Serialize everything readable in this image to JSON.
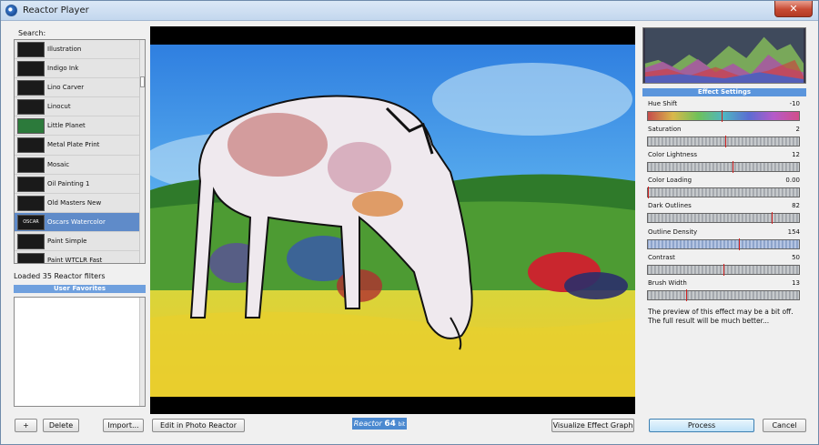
{
  "window": {
    "title": "Reactor Player",
    "close_glyph": "✕"
  },
  "left_panel": {
    "search_label": "Search:",
    "filters": [
      {
        "name": "Illustration",
        "icon": "illustration-thumb-icon"
      },
      {
        "name": "Indigo Ink",
        "icon": "indigo-ink-thumb-icon"
      },
      {
        "name": "Lino Carver",
        "icon": "lino-carver-thumb-icon"
      },
      {
        "name": "Linocut",
        "icon": "linocut-thumb-icon"
      },
      {
        "name": "Little Planet",
        "icon": "little-planet-thumb-icon"
      },
      {
        "name": "Metal Plate Print",
        "icon": "metal-plate-thumb-icon"
      },
      {
        "name": "Mosaic",
        "icon": "mosaic-thumb-icon"
      },
      {
        "name": "Oil Painting 1",
        "icon": "oil-painting-thumb-icon"
      },
      {
        "name": "Old Masters New",
        "icon": "old-masters-thumb-icon"
      },
      {
        "name": "Oscars Watercolor",
        "icon": "oscars-watercolor-thumb-icon",
        "thumb_text": "OSCAR"
      },
      {
        "name": "Paint Simple",
        "icon": "paint-simple-thumb-icon"
      },
      {
        "name": "Paint WTCLR Fast",
        "icon": "paint-wtclr-thumb-icon"
      }
    ],
    "selected_filter": "Oscars Watercolor",
    "loaded_text": "Loaded 35 Reactor filters",
    "favorites_header": "User Favorites"
  },
  "buttons": {
    "add": "+",
    "delete": "Delete",
    "import": "Import...",
    "edit": "Edit in Photo Reactor",
    "visualize": "Visualize Effect Graph",
    "process": "Process",
    "cancel": "Cancel"
  },
  "badge": {
    "brand": "Reactor",
    "num": "64",
    "unit": "bit"
  },
  "effect_settings": {
    "header": "Effect Settings",
    "sliders": [
      {
        "label": "Hue Shift",
        "value": "-10",
        "fraction": 0.49,
        "style": "hue"
      },
      {
        "label": "Saturation",
        "value": "2",
        "fraction": 0.51,
        "style": "gray"
      },
      {
        "label": "Color Lightness",
        "value": "12",
        "fraction": 0.56,
        "style": "gray"
      },
      {
        "label": "Color Loading",
        "value": "0.00",
        "fraction": 0.0,
        "style": "gray"
      },
      {
        "label": "Dark Outlines",
        "value": "82",
        "fraction": 0.82,
        "style": "gray"
      },
      {
        "label": "Outline Density",
        "value": "154",
        "fraction": 0.6,
        "style": "blue"
      },
      {
        "label": "Contrast",
        "value": "50",
        "fraction": 0.5,
        "style": "gray"
      },
      {
        "label": "Brush Width",
        "value": "13",
        "fraction": 0.25,
        "style": "gray"
      }
    ],
    "note": "The preview of this effect may be a bit off. The full result will be much better..."
  },
  "colors": {
    "accent": "#5b95dc",
    "selection": "#5f8bc9",
    "marker": "#d12020"
  }
}
